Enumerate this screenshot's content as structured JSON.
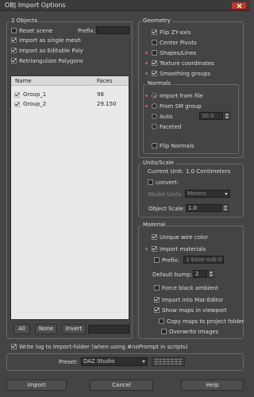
{
  "window": {
    "title": "OBJ Import Options"
  },
  "objects": {
    "group_label": "2 Objects",
    "reset_scene": {
      "label": "Reset scene",
      "checked": false
    },
    "prefix_label": "Prefix:",
    "prefix_value": "",
    "import_single_mesh": {
      "label": "Import as single mesh",
      "checked": true
    },
    "import_editable_poly": {
      "label": "Import as Editable Poly",
      "checked": true
    },
    "retriangulate": {
      "label": "Retriangulate Polygons",
      "checked": true
    },
    "list": {
      "columns": [
        "Name",
        "Faces"
      ],
      "rows": [
        {
          "name": "Group_1",
          "faces": "98",
          "checked": true
        },
        {
          "name": "Group_2",
          "faces": "29.150",
          "checked": true
        }
      ]
    },
    "all_button": "All",
    "none_button": "None",
    "invert_button": "Invert"
  },
  "geometry": {
    "group_label": "Geometry",
    "flip_zy": {
      "label": "Flip ZY-axis",
      "checked": true
    },
    "center_pivots": {
      "label": "Center Pivots",
      "checked": false
    },
    "shapes_lines": {
      "label": "Shapes/Lines",
      "checked": false
    },
    "texture_coords": {
      "label": "Texture coordinates",
      "checked": true
    },
    "smoothing_groups": {
      "label": "Smoothing groups",
      "checked": true
    }
  },
  "normals": {
    "group_label": "Normals",
    "import_from_file": {
      "label": "Import from file",
      "selected": true
    },
    "from_sm_group": {
      "label": "From SM group",
      "selected": false
    },
    "auto": {
      "label": "Auto",
      "selected": false
    },
    "auto_value": "30.0",
    "faceted": {
      "label": "Faceted",
      "selected": false
    },
    "flip_normals": {
      "label": "Flip Normals",
      "checked": false
    }
  },
  "units": {
    "group_label": "Units/Scale",
    "current_unit_label": "Current Unit:",
    "current_unit_value": "1.0 Centimeters",
    "convert": {
      "label": "convert:",
      "checked": false
    },
    "model_units_label": "Model Units:",
    "model_units_value": "Meters",
    "object_scale_label": "Object Scale:",
    "object_scale_value": "1.0"
  },
  "material": {
    "group_label": "Material",
    "unique_wire_color": {
      "label": "Unique wire color",
      "checked": true
    },
    "import_materials": {
      "label": "Import materials",
      "checked": true
    },
    "prefix": {
      "label": "Prefix:",
      "checked": false,
      "value": "1-base-sub-0"
    },
    "default_bump_label": "Default bump:",
    "default_bump_value": "2",
    "force_black_ambient": {
      "label": "Force black ambient",
      "checked": false
    },
    "import_into_mat_editor": {
      "label": "Import into Mat-Editor",
      "checked": true
    },
    "show_maps_in_viewport": {
      "label": "Show maps in viewport",
      "checked": true
    },
    "copy_maps": {
      "label": "Copy maps to project folder",
      "checked": false
    },
    "overwrite_images": {
      "label": "Overwrite Images",
      "checked": false
    }
  },
  "footer": {
    "write_log": {
      "label": "Write log to Import-folder (when using #noPrompt in scripts)",
      "checked": true
    },
    "preset_label": "Preset:",
    "preset_value": "DAZ Studio",
    "import_button": "Import",
    "cancel_button": "Cancel",
    "help_button": "Help"
  },
  "colors": {
    "background": "#444444",
    "close_button": "#c0392b",
    "marker": "#c05a8a"
  }
}
